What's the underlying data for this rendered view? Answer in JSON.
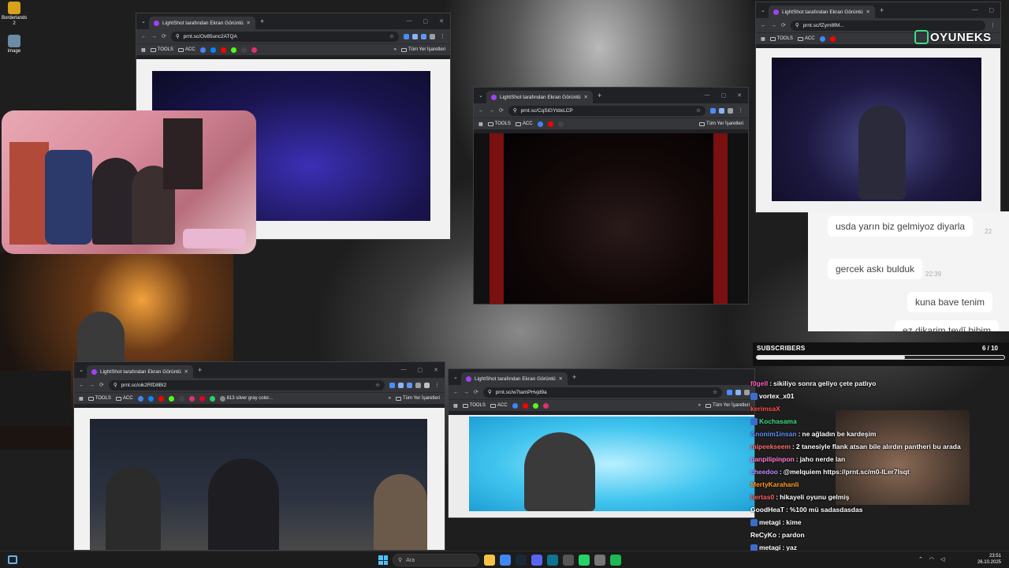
{
  "desktop": {
    "icons": [
      {
        "label": "Borderlands 2",
        "color": "#d9a21b"
      },
      {
        "label": "image",
        "color": "#6c8ba6"
      }
    ]
  },
  "browser": {
    "tab_title": "LightShot tarafından Ekran Görüntüsü",
    "bookmarks": {
      "tools": "TOOLS",
      "acc": "ACC",
      "all_bookmarks": "Tüm Yer İşaretleri",
      "extra_item": "613 silver gray color..."
    },
    "windows": [
      {
        "id": "win-top-left",
        "url": "prnt.sc/Ov85unc2ATQA"
      },
      {
        "id": "win-center",
        "url": "prnt.sc/CqSiGYtdxLCP"
      },
      {
        "id": "win-top-right",
        "url": "prnt.sc/fZym8fM..."
      },
      {
        "id": "win-bottom-left",
        "url": "prnt.sc/oik2RfD8Bl2"
      },
      {
        "id": "win-bottom-mid",
        "url": "prnt.sc/w7tamPHvjd9a"
      },
      {
        "id": "win-bottom-right",
        "url": "prnt.sc/X0HP..."
      }
    ]
  },
  "logo": {
    "text": "OYUNEKS"
  },
  "bubbles": [
    {
      "text": "usda yarın biz gelmiyoz diyarla",
      "time": "22"
    },
    {
      "text": "gercek askı bulduk",
      "time": "22:39"
    },
    {
      "text": "kuna bave tenim",
      "time": ""
    },
    {
      "text": "ez dikarim tevlî bibim",
      "time": ""
    }
  ],
  "subscribers": {
    "label": "SUBSCRIBERS",
    "current": 6,
    "goal": 10,
    "count_text": "6 / 10"
  },
  "chat": [
    {
      "user": "f0gell",
      "color": "#ff5ebc",
      "text": "sikiliyo sonra geliyo çete patlıyo",
      "badge": false
    },
    {
      "user": "vortex_x01",
      "color": "#ffffff",
      "text": "",
      "badge": true
    },
    {
      "user": "kerimsaX",
      "color": "#ff4d4d",
      "text": "",
      "badge": false
    },
    {
      "user": "Kochasama",
      "color": "#3ddc84",
      "text": "",
      "badge": true
    },
    {
      "user": "Anonim1insan",
      "color": "#5b8cff",
      "text": "ne ağladın be kardeşim",
      "badge": false
    },
    {
      "user": "mipeekseem",
      "color": "#ff6b6b",
      "text": "2 tanesiyle flank atsan bile alırdın pantheri bu arada",
      "badge": false
    },
    {
      "user": "panpilipinpon",
      "color": "#ff7dd6",
      "text": "jaho nerde lan",
      "badge": false
    },
    {
      "user": "cheedoo",
      "color": "#c08cff",
      "text": "@melquiem https://prnt.sc/m0-ILer7lsqt",
      "badge": false
    },
    {
      "user": "MertyKarahanli",
      "color": "#ff9a1f",
      "text": "",
      "badge": false
    },
    {
      "user": "bertas0",
      "color": "#ff5e5e",
      "text": "hikayeli oyunu gelmiş",
      "badge": false
    },
    {
      "user": "GoodHeaT",
      "color": "#ffffff",
      "text": "%100 mü sadasdasdas",
      "badge": false
    },
    {
      "user": "metagi",
      "color": "#ffffff",
      "text": "kime",
      "badge": true
    },
    {
      "user": "ReCyKo",
      "color": "#ffffff",
      "text": "pardon",
      "badge": false
    },
    {
      "user": "metagi",
      "color": "#ffffff",
      "text": "yaz",
      "badge": true
    },
    {
      "user": "na",
      "color": "#ffffff",
      "text": "",
      "badge": false
    }
  ],
  "taskbar": {
    "search_placeholder": "Ara",
    "time": "23:51",
    "date": "26.10.2025"
  }
}
